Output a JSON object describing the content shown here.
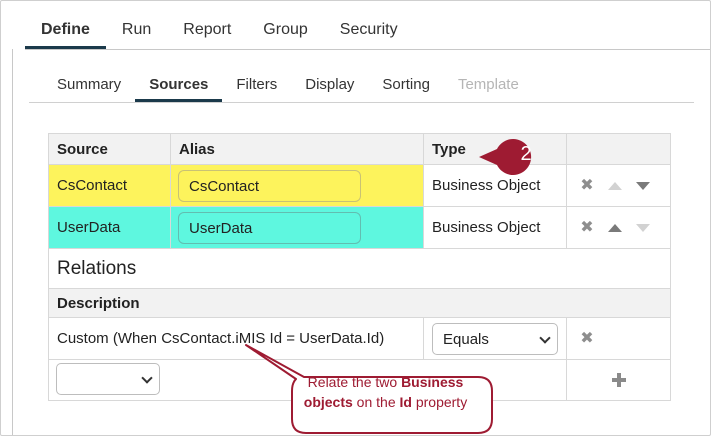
{
  "top_tabs": [
    "Define",
    "Run",
    "Report",
    "Group",
    "Security"
  ],
  "sub_tabs": [
    "Summary",
    "Sources",
    "Filters",
    "Display",
    "Sorting",
    "Template"
  ],
  "sources_table": {
    "headers": {
      "source": "Source",
      "alias": "Alias",
      "type": "Type"
    },
    "rows": [
      {
        "source": "CsContact",
        "alias": "CsContact",
        "type": "Business Object",
        "highlight": "#fdf35c"
      },
      {
        "source": "UserData",
        "alias": "UserData",
        "type": "Business Object",
        "highlight": "#5ef7df"
      }
    ]
  },
  "relations": {
    "title": "Relations",
    "description_header": "Description",
    "rows": [
      {
        "description": "Custom (When CsContact.iMIS Id = UserData.Id)",
        "operator": "Equals"
      }
    ],
    "new_row_select": ""
  },
  "callouts": {
    "step_number": "2",
    "tooltip_parts": [
      "Relate the two ",
      "Business objects",
      " on the ",
      "Id",
      " property"
    ],
    "accent_color": "#9e1b32"
  },
  "icons": {
    "remove": "x-icon",
    "move_up": "arrow-up-icon",
    "move_down": "arrow-down-icon",
    "add": "plus-icon"
  }
}
